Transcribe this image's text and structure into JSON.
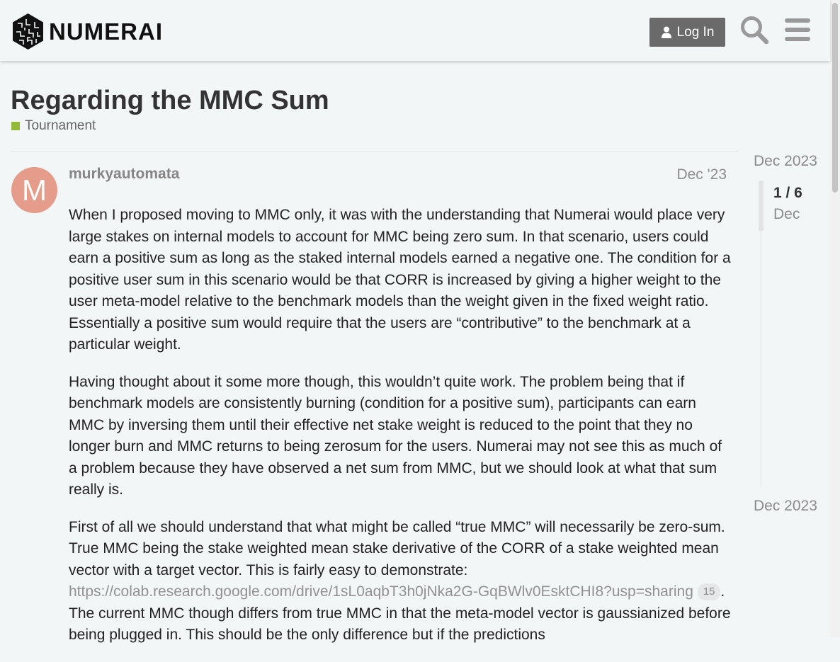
{
  "header": {
    "logo_text": "NUMERAI",
    "login_label": "Log In"
  },
  "topic": {
    "title": "Regarding the MMC Sum",
    "category": "Tournament",
    "category_color": "#92b937"
  },
  "post": {
    "avatar_letter": "M",
    "avatar_color": "#e59c8b",
    "username": "murkyautomata",
    "date": "Dec '23",
    "paragraph1": "When I proposed moving to MMC only, it was with the understanding that Numerai would place very large stakes on internal models to account for MMC being zero sum. In that scenario, users could earn a positive sum as long as the staked internal models earned a negative one. The condition for a positive user sum in this scenario would be that CORR is increased by giving a higher weight to the user meta-model relative to the benchmark models than the weight given in the fixed weight ratio. Essentially a positive sum would require that the users are “contributive” to the benchmark at a particular weight.",
    "paragraph2": "Having thought about it some more though, this wouldn’t quite work. The problem being that if benchmark models are consistently burning (condition for a positive sum), participants can earn MMC by inversing them until their effective net stake weight is reduced to the point that they no longer burn and MMC returns to being zerosum for the users. Numerai may not see this as much of a problem because they have observed a net sum from MMC, but we should look at what that sum really is.",
    "paragraph3_start": "First of all we should understand that what might be called “true MMC” will necessarily be zero-sum. True MMC being the stake weighted mean stake derivative of the CORR of a stake weighted mean vector with a target vector. This is fairly easy to demonstrate: ",
    "link_text": "https://colab.research.google.com/drive/1sL0aqbT3h0jNka2G-GqBWlv0EsktCHI8?usp=sharing",
    "link_clicks": "15",
    "paragraph3_end": ". The current MMC though differs from true MMC in that the meta-model vector is gaussianized before being plugged in. This should be the only difference but if the predictions"
  },
  "timeline": {
    "top_date": "Dec 2023",
    "position": "1 / 6",
    "position_date": "Dec",
    "bottom_date": "Dec 2023"
  }
}
